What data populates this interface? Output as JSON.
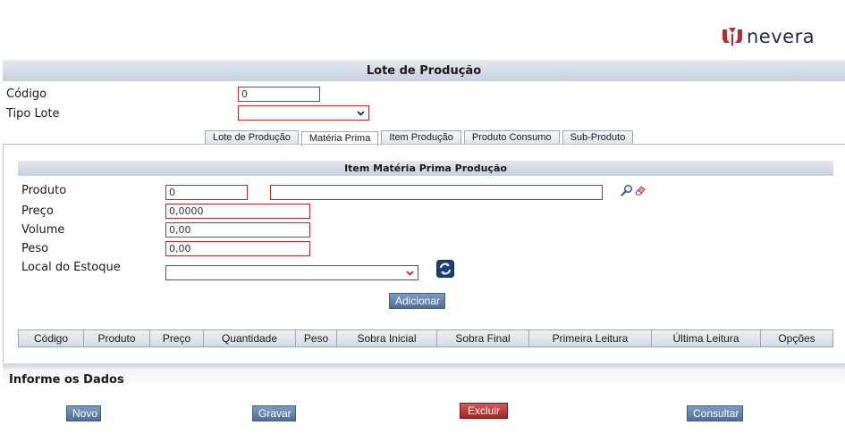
{
  "brand": {
    "logo_text": "nevera"
  },
  "page": {
    "title": "Lote de Produção"
  },
  "header_form": {
    "codigo_label": "Código",
    "codigo_value": "0",
    "tipo_lote_label": "Tipo Lote",
    "tipo_lote_value": ""
  },
  "tabs": [
    {
      "label": "Lote de Produção",
      "active": false
    },
    {
      "label": "Matéria Prima",
      "active": true
    },
    {
      "label": "Item Produção",
      "active": false
    },
    {
      "label": "Produto Consumo",
      "active": false
    },
    {
      "label": "Sub-Produto",
      "active": false
    }
  ],
  "materia_prima": {
    "section_title": "Item Matéria Prima Produção",
    "produto_label": "Produto",
    "produto_code": "0",
    "produto_desc": "",
    "preco_label": "Preço",
    "preco_value": "0,0000",
    "volume_label": "Volume",
    "volume_value": "0,00",
    "peso_label": "Peso",
    "peso_value": "0,00",
    "local_label": "Local do Estoque",
    "local_value": "",
    "add_button": "Adicionar",
    "icons": {
      "search": "search-icon",
      "clear": "eraser-icon",
      "refresh": "refresh-icon"
    }
  },
  "table": {
    "columns": [
      "Código",
      "Produto",
      "Preço",
      "Quantidade",
      "Peso",
      "Sobra Inicial",
      "Sobra Final",
      "Primeira Leitura",
      "Última Leitura",
      "Opções"
    ],
    "rows": []
  },
  "footer": {
    "title": "Informe os Dados",
    "new_button": "Novo",
    "save_button": "Gravar",
    "delete_button": "Excluir",
    "query_button": "Consultar"
  },
  "colors": {
    "field_border": "#c0282d",
    "button_blue": "#4e6f97",
    "button_red": "#a82424",
    "header_bar": "#c6cfdc",
    "logo_red": "#c0282d",
    "logo_text": "#1f2a44"
  }
}
